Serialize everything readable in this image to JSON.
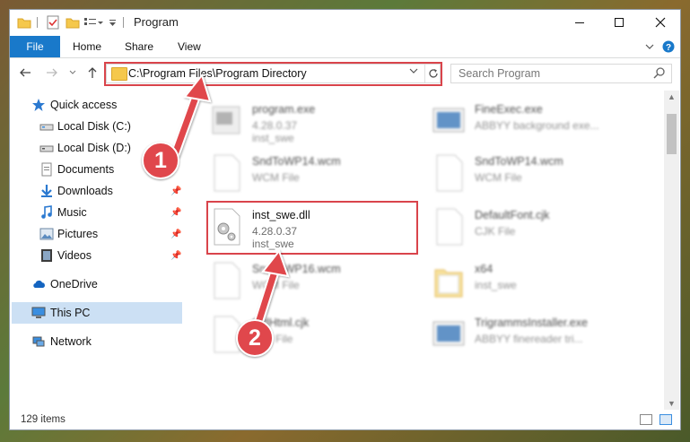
{
  "window": {
    "title": "Program"
  },
  "ribbon": {
    "tabs": [
      "File",
      "Home",
      "Share",
      "View"
    ]
  },
  "address": {
    "path": "C:\\Program Files\\Program Directory"
  },
  "search": {
    "placeholder": "Search Program"
  },
  "sidebar": {
    "items": [
      {
        "label": "Quick access",
        "icon": "star-icon",
        "pinned": false
      },
      {
        "label": "Local Disk (C:)",
        "icon": "drive-icon",
        "pinned": false
      },
      {
        "label": "Local Disk (D:)",
        "icon": "drive-icon",
        "pinned": false
      },
      {
        "label": "Documents",
        "icon": "documents-icon",
        "pinned": false
      },
      {
        "label": "Downloads",
        "icon": "download-icon",
        "pinned": true
      },
      {
        "label": "Music",
        "icon": "music-icon",
        "pinned": true
      },
      {
        "label": "Pictures",
        "icon": "pictures-icon",
        "pinned": true
      },
      {
        "label": "Videos",
        "icon": "videos-icon",
        "pinned": true
      },
      {
        "label": "OneDrive",
        "icon": "cloud-icon",
        "pinned": false
      },
      {
        "label": "This PC",
        "icon": "pc-icon",
        "pinned": false,
        "selected": true
      },
      {
        "label": "Network",
        "icon": "network-icon",
        "pinned": false
      }
    ]
  },
  "files": {
    "left": [
      {
        "name": "program.exe",
        "line2": "4.28.0.37",
        "line3": "inst_swe"
      },
      {
        "name": "SndToWP14.wcm",
        "line2": "WCM File",
        "line3": ""
      },
      {
        "name": "inst_swe.dll",
        "line2": "4.28.0.37",
        "line3": "inst_swe"
      },
      {
        "name": "SndToWP16.wcm",
        "line2": "WCM File",
        "line3": ""
      },
      {
        "name": "StdHtml.cjk",
        "line2": "CJK File",
        "line3": ""
      }
    ],
    "right": [
      {
        "name": "FineExec.exe",
        "line2": "ABBYY background exe...",
        "line3": ""
      },
      {
        "name": "SndToWP14.wcm",
        "line2": "WCM File",
        "line3": ""
      },
      {
        "name": "DefaultFont.cjk",
        "line2": "CJK File",
        "line3": ""
      },
      {
        "name": "x64",
        "line2": "inst_swe",
        "line3": ""
      },
      {
        "name": "TrigrammsInstaller.exe",
        "line2": "ABBYY finereader tri...",
        "line3": ""
      }
    ]
  },
  "status": {
    "count": "129 items"
  },
  "annotations": {
    "badge1": "1",
    "badge2": "2",
    "highlight_color": "#d9444b"
  }
}
